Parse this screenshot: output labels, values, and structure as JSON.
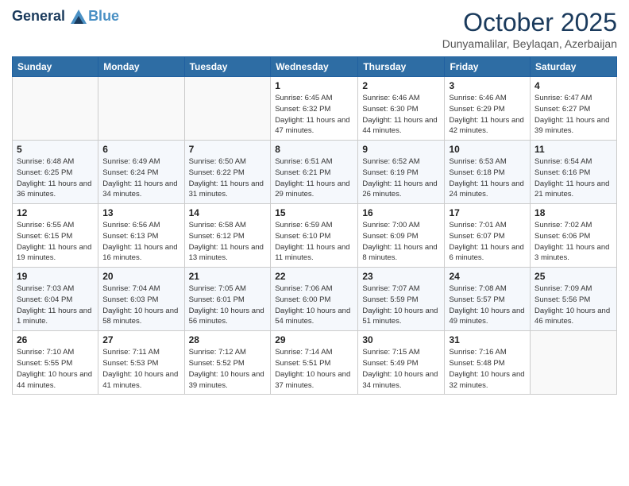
{
  "header": {
    "logo_line1": "General",
    "logo_line2": "Blue",
    "month_title": "October 2025",
    "location": "Dunyamalilar, Beylaqan, Azerbaijan"
  },
  "weekdays": [
    "Sunday",
    "Monday",
    "Tuesday",
    "Wednesday",
    "Thursday",
    "Friday",
    "Saturday"
  ],
  "weeks": [
    [
      {
        "day": "",
        "info": ""
      },
      {
        "day": "",
        "info": ""
      },
      {
        "day": "",
        "info": ""
      },
      {
        "day": "1",
        "info": "Sunrise: 6:45 AM\nSunset: 6:32 PM\nDaylight: 11 hours and 47 minutes."
      },
      {
        "day": "2",
        "info": "Sunrise: 6:46 AM\nSunset: 6:30 PM\nDaylight: 11 hours and 44 minutes."
      },
      {
        "day": "3",
        "info": "Sunrise: 6:46 AM\nSunset: 6:29 PM\nDaylight: 11 hours and 42 minutes."
      },
      {
        "day": "4",
        "info": "Sunrise: 6:47 AM\nSunset: 6:27 PM\nDaylight: 11 hours and 39 minutes."
      }
    ],
    [
      {
        "day": "5",
        "info": "Sunrise: 6:48 AM\nSunset: 6:25 PM\nDaylight: 11 hours and 36 minutes."
      },
      {
        "day": "6",
        "info": "Sunrise: 6:49 AM\nSunset: 6:24 PM\nDaylight: 11 hours and 34 minutes."
      },
      {
        "day": "7",
        "info": "Sunrise: 6:50 AM\nSunset: 6:22 PM\nDaylight: 11 hours and 31 minutes."
      },
      {
        "day": "8",
        "info": "Sunrise: 6:51 AM\nSunset: 6:21 PM\nDaylight: 11 hours and 29 minutes."
      },
      {
        "day": "9",
        "info": "Sunrise: 6:52 AM\nSunset: 6:19 PM\nDaylight: 11 hours and 26 minutes."
      },
      {
        "day": "10",
        "info": "Sunrise: 6:53 AM\nSunset: 6:18 PM\nDaylight: 11 hours and 24 minutes."
      },
      {
        "day": "11",
        "info": "Sunrise: 6:54 AM\nSunset: 6:16 PM\nDaylight: 11 hours and 21 minutes."
      }
    ],
    [
      {
        "day": "12",
        "info": "Sunrise: 6:55 AM\nSunset: 6:15 PM\nDaylight: 11 hours and 19 minutes."
      },
      {
        "day": "13",
        "info": "Sunrise: 6:56 AM\nSunset: 6:13 PM\nDaylight: 11 hours and 16 minutes."
      },
      {
        "day": "14",
        "info": "Sunrise: 6:58 AM\nSunset: 6:12 PM\nDaylight: 11 hours and 13 minutes."
      },
      {
        "day": "15",
        "info": "Sunrise: 6:59 AM\nSunset: 6:10 PM\nDaylight: 11 hours and 11 minutes."
      },
      {
        "day": "16",
        "info": "Sunrise: 7:00 AM\nSunset: 6:09 PM\nDaylight: 11 hours and 8 minutes."
      },
      {
        "day": "17",
        "info": "Sunrise: 7:01 AM\nSunset: 6:07 PM\nDaylight: 11 hours and 6 minutes."
      },
      {
        "day": "18",
        "info": "Sunrise: 7:02 AM\nSunset: 6:06 PM\nDaylight: 11 hours and 3 minutes."
      }
    ],
    [
      {
        "day": "19",
        "info": "Sunrise: 7:03 AM\nSunset: 6:04 PM\nDaylight: 11 hours and 1 minute."
      },
      {
        "day": "20",
        "info": "Sunrise: 7:04 AM\nSunset: 6:03 PM\nDaylight: 10 hours and 58 minutes."
      },
      {
        "day": "21",
        "info": "Sunrise: 7:05 AM\nSunset: 6:01 PM\nDaylight: 10 hours and 56 minutes."
      },
      {
        "day": "22",
        "info": "Sunrise: 7:06 AM\nSunset: 6:00 PM\nDaylight: 10 hours and 54 minutes."
      },
      {
        "day": "23",
        "info": "Sunrise: 7:07 AM\nSunset: 5:59 PM\nDaylight: 10 hours and 51 minutes."
      },
      {
        "day": "24",
        "info": "Sunrise: 7:08 AM\nSunset: 5:57 PM\nDaylight: 10 hours and 49 minutes."
      },
      {
        "day": "25",
        "info": "Sunrise: 7:09 AM\nSunset: 5:56 PM\nDaylight: 10 hours and 46 minutes."
      }
    ],
    [
      {
        "day": "26",
        "info": "Sunrise: 7:10 AM\nSunset: 5:55 PM\nDaylight: 10 hours and 44 minutes."
      },
      {
        "day": "27",
        "info": "Sunrise: 7:11 AM\nSunset: 5:53 PM\nDaylight: 10 hours and 41 minutes."
      },
      {
        "day": "28",
        "info": "Sunrise: 7:12 AM\nSunset: 5:52 PM\nDaylight: 10 hours and 39 minutes."
      },
      {
        "day": "29",
        "info": "Sunrise: 7:14 AM\nSunset: 5:51 PM\nDaylight: 10 hours and 37 minutes."
      },
      {
        "day": "30",
        "info": "Sunrise: 7:15 AM\nSunset: 5:49 PM\nDaylight: 10 hours and 34 minutes."
      },
      {
        "day": "31",
        "info": "Sunrise: 7:16 AM\nSunset: 5:48 PM\nDaylight: 10 hours and 32 minutes."
      },
      {
        "day": "",
        "info": ""
      }
    ]
  ]
}
